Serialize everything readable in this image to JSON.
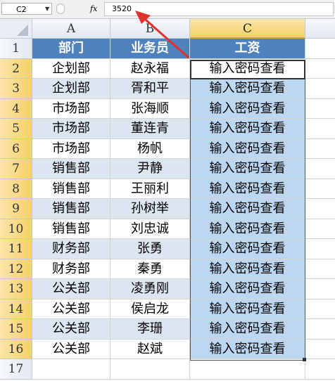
{
  "formula_bar": {
    "name_box": "C2",
    "fx_label": "fx",
    "formula": "3520"
  },
  "columns": [
    "A",
    "B",
    "C"
  ],
  "selected_column": "C",
  "rows": [
    "1",
    "2",
    "3",
    "4",
    "5",
    "6",
    "7",
    "8",
    "9",
    "10",
    "11",
    "12",
    "13",
    "14",
    "15",
    "16",
    "17"
  ],
  "headers": {
    "a": "部门",
    "b": "业务员",
    "c": "工资"
  },
  "data": [
    {
      "dept": "企划部",
      "name": "赵永福",
      "salary": "输入密码查看"
    },
    {
      "dept": "企划部",
      "name": "胥和平",
      "salary": "输入密码查看"
    },
    {
      "dept": "市场部",
      "name": "张海顺",
      "salary": "输入密码查看"
    },
    {
      "dept": "市场部",
      "name": "董连青",
      "salary": "输入密码查看"
    },
    {
      "dept": "市场部",
      "name": "杨帆",
      "salary": "输入密码查看"
    },
    {
      "dept": "销售部",
      "name": "尹静",
      "salary": "输入密码查看"
    },
    {
      "dept": "销售部",
      "name": "王丽利",
      "salary": "输入密码查看"
    },
    {
      "dept": "销售部",
      "name": "孙树举",
      "salary": "输入密码查看"
    },
    {
      "dept": "销售部",
      "name": "刘忠诚",
      "salary": "输入密码查看"
    },
    {
      "dept": "财务部",
      "name": "张勇",
      "salary": "输入密码查看"
    },
    {
      "dept": "财务部",
      "name": "秦勇",
      "salary": "输入密码查看"
    },
    {
      "dept": "公关部",
      "name": "凌勇刚",
      "salary": "输入密码查看"
    },
    {
      "dept": "公关部",
      "name": "侯启龙",
      "salary": "输入密码查看"
    },
    {
      "dept": "公关部",
      "name": "李珊",
      "salary": "输入密码查看"
    },
    {
      "dept": "公关部",
      "name": "赵斌",
      "salary": "输入密码查看"
    }
  ],
  "colors": {
    "header_fill": "#4f81bd",
    "band_fill": "#dce6f1",
    "selection_fill": "#bcd7f1",
    "selected_header": "#f5cf6a",
    "annotation_arrow": "#e03030"
  }
}
